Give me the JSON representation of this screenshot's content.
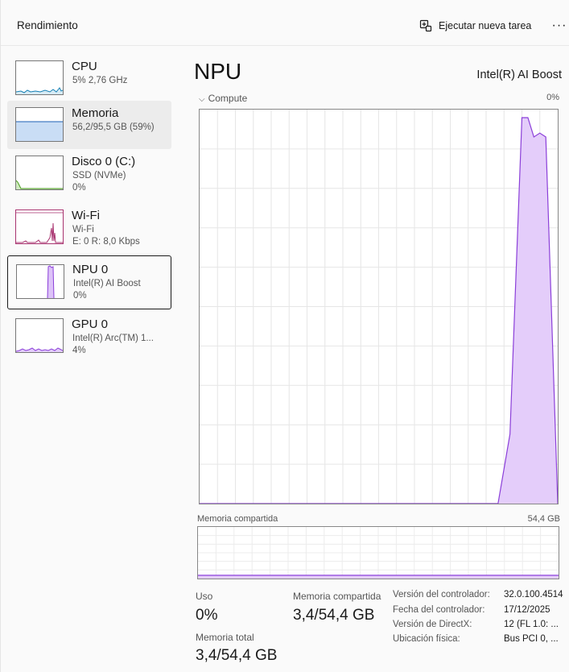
{
  "header": {
    "title": "Rendimiento",
    "run_task_label": "Ejecutar nueva tarea",
    "more_label": "···"
  },
  "sidebar": {
    "items": [
      {
        "name": "CPU",
        "sub": "5% 2,76 GHz",
        "sub2": ""
      },
      {
        "name": "Memoria",
        "sub": "56,2/95,5 GB (59%)",
        "sub2": ""
      },
      {
        "name": "Disco 0 (C:)",
        "sub": "SSD (NVMe)",
        "sub2": "0%"
      },
      {
        "name": "Wi-Fi",
        "sub": "Wi-Fi",
        "sub2": "E: 0 R: 8,0 Kbps"
      },
      {
        "name": "NPU 0",
        "sub": "Intel(R) AI Boost",
        "sub2": "0%"
      },
      {
        "name": "GPU 0",
        "sub": "Intel(R) Arc(TM) 1...",
        "sub2": "4%"
      }
    ]
  },
  "main": {
    "title": "NPU",
    "device": "Intel(R) AI Boost",
    "compute_label": "Compute",
    "compute_pct": "0%",
    "shared_mem_label": "Memoria compartida",
    "shared_mem_max": "54,4 GB"
  },
  "stats": {
    "uso_label": "Uso",
    "uso_value": "0%",
    "shared_label": "Memoria compartida",
    "shared_value": "3,4/54,4 GB",
    "total_label": "Memoria total",
    "total_value": "3,4/54,4 GB"
  },
  "details": [
    {
      "key": "Versión del controlador:",
      "value": "32.0.100.4514"
    },
    {
      "key": "Fecha del controlador:",
      "value": "17/12/2025"
    },
    {
      "key": "Versión de DirectX:",
      "value": "12 (FL 1.0: ..."
    },
    {
      "key": "Ubicación física:",
      "value": "Bus PCI 0, ..."
    }
  ],
  "chart_data": {
    "type": "area",
    "title": "Compute",
    "ylim": [
      0,
      100
    ],
    "x": [
      0,
      5,
      10,
      15,
      20,
      25,
      30,
      35,
      40,
      45,
      50,
      52,
      54,
      55,
      56,
      57,
      58,
      60
    ],
    "series": [
      {
        "values": [
          0,
          0,
          0,
          0,
          0,
          0,
          0,
          0,
          0,
          0,
          0,
          18,
          100,
          100,
          95,
          96,
          95,
          0
        ]
      }
    ],
    "colors": {
      "line": "#8b3fd9",
      "fill": "#e4cdfa"
    },
    "grid": true
  }
}
